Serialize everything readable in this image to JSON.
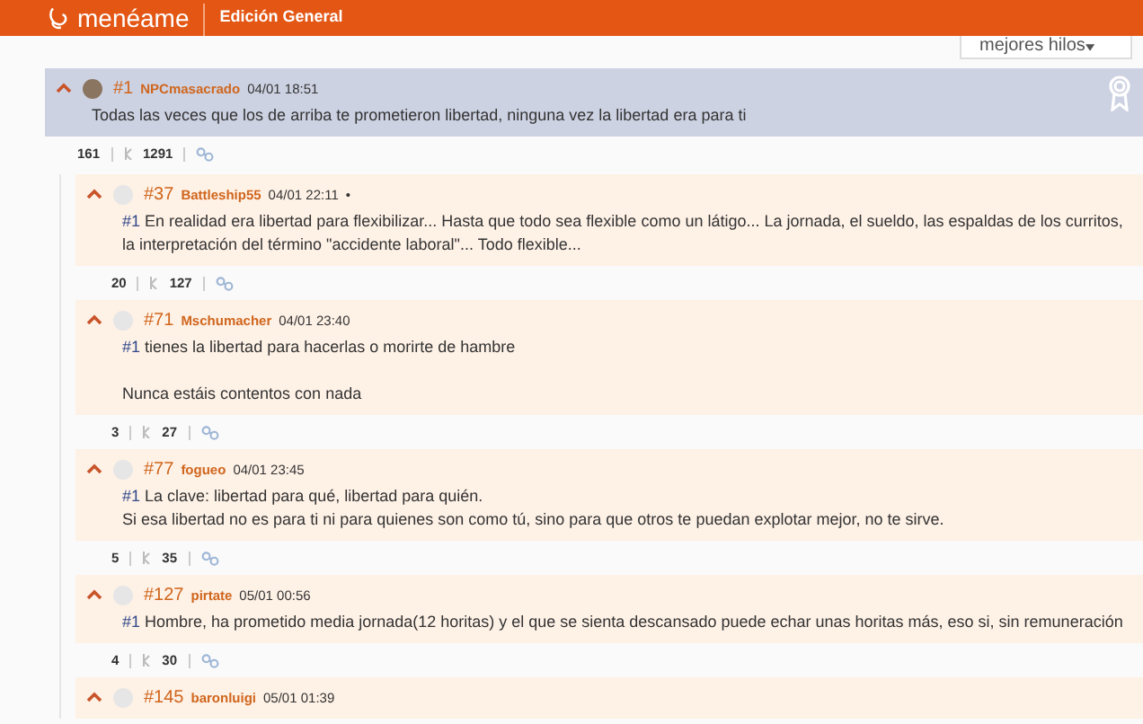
{
  "header": {
    "logo": "menéame",
    "edition": "Edición General"
  },
  "sort": {
    "value": "mejores hilos"
  },
  "main_comment": {
    "number": "#1",
    "user": "NPCmasacrado",
    "date": "04/01 18:51",
    "highlighted": true,
    "paragraphs": [
      {
        "lines": [
          {
            "text": "Todas las veces que los de arriba te prometieron libertad, ninguna vez la libertad era para ti"
          }
        ]
      }
    ],
    "votes": "161",
    "karma": "1291"
  },
  "replies": [
    {
      "number": "#37",
      "user": "Battleship55",
      "date": "04/01 22:11",
      "bullet": "•",
      "highlighted": false,
      "paragraphs": [
        {
          "lines": [
            {
              "ref": "#1",
              "text": "En realidad era libertad para flexibilizar... Hasta que todo sea flexible como un látigo... La jornada, el sueldo, las espaldas de los curritos, la interpretación del término \"accidente laboral\"... Todo flexible..."
            }
          ]
        }
      ],
      "votes": "20",
      "karma": "127"
    },
    {
      "number": "#71",
      "user": "Mschumacher",
      "date": "04/01 23:40",
      "highlighted": false,
      "paragraphs": [
        {
          "lines": [
            {
              "ref": "#1",
              "text": "tienes la libertad para hacerlas o morirte de hambre"
            }
          ]
        },
        {
          "lines": [
            {
              "text": "Nunca estáis contentos con nada"
            }
          ]
        }
      ],
      "votes": "3",
      "karma": "27"
    },
    {
      "number": "#77",
      "user": "fogueo",
      "date": "04/01 23:45",
      "highlighted": false,
      "paragraphs": [
        {
          "lines": [
            {
              "ref": "#1",
              "text": "La clave: libertad para qué, libertad para quién."
            },
            {
              "text": "Si esa libertad no es para ti ni para quienes son como tú, sino para que otros te puedan explotar mejor, no te sirve."
            }
          ]
        }
      ],
      "votes": "5",
      "karma": "35"
    },
    {
      "number": "#127",
      "user": "pirtate",
      "date": "05/01 00:56",
      "highlighted": false,
      "paragraphs": [
        {
          "lines": [
            {
              "ref": "#1",
              "text": "Hombre, ha prometido media jornada(12 horitas) y el que se sienta descansado puede echar unas horitas más, eso si, sin remuneración"
            }
          ]
        }
      ],
      "votes": "4",
      "karma": "30"
    },
    {
      "number": "#145",
      "user": "baronluigi",
      "date": "05/01 01:39",
      "highlighted": false
    }
  ]
}
